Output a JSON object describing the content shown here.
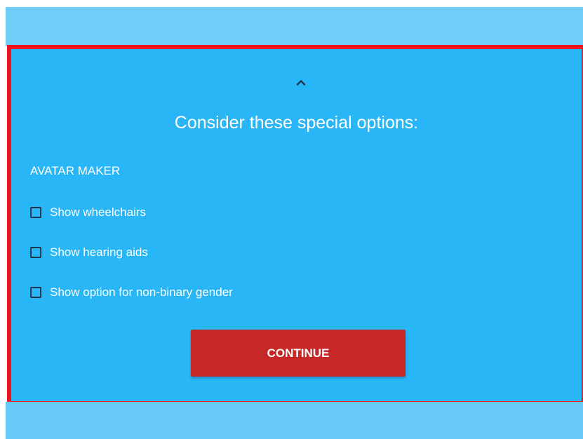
{
  "panel": {
    "collapse_icon": "chevron-up-icon",
    "title": "Consider these special options:",
    "section_label": "AVATAR MAKER",
    "options": [
      {
        "label": "Show wheelchairs",
        "checked": false
      },
      {
        "label": "Show hearing aids",
        "checked": false
      },
      {
        "label": "Show option for non-binary gender",
        "checked": false
      }
    ],
    "continue_label": "CONTINUE"
  },
  "colors": {
    "panel_background": "#29b6f6",
    "panel_border": "#f0141e",
    "outer_background": "#6fcdf7",
    "continue_button": "#c62828",
    "checkbox_border": "#1d3550",
    "text": "#ffffff"
  }
}
